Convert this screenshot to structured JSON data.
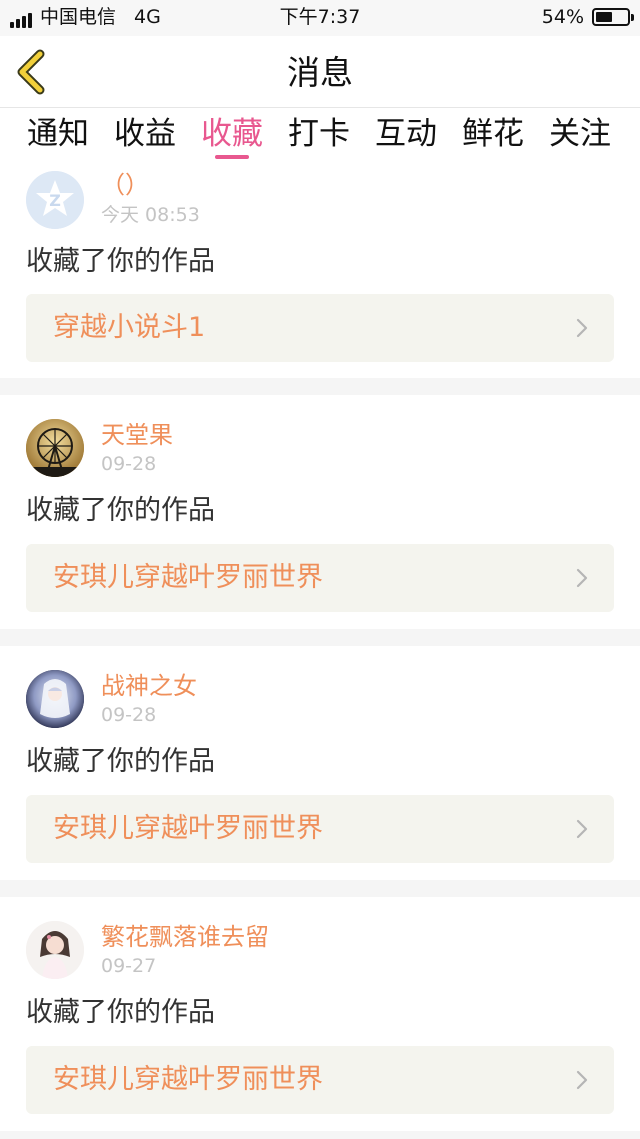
{
  "status_bar": {
    "carrier": "中国电信",
    "network": "4G",
    "time": "下午7:37",
    "battery_percent": "54%",
    "battery_level": 0.54
  },
  "header": {
    "title": "消息",
    "back_icon": "back-chevron-icon"
  },
  "tabs": [
    {
      "label": "通知",
      "active": false
    },
    {
      "label": "收益",
      "active": false
    },
    {
      "label": "收藏",
      "active": true
    },
    {
      "label": "打卡",
      "active": false
    },
    {
      "label": "互动",
      "active": false
    },
    {
      "label": "鲜花",
      "active": false
    },
    {
      "label": "关注",
      "active": false
    }
  ],
  "colors": {
    "accent": "#e8588f",
    "name_orange": "#ef8f5a",
    "box_bg": "#f4f4ee"
  },
  "feed": [
    {
      "user": "（）",
      "date": "今天 08:53",
      "action": "收藏了你的作品",
      "work": "穿越小说斗1",
      "avatar": "default-z-avatar"
    },
    {
      "user": "天堂果",
      "date": "09-28",
      "action": "收藏了你的作品",
      "work": "安琪儿穿越叶罗丽世界",
      "avatar": "ferris-wheel-avatar"
    },
    {
      "user": "战神之女",
      "date": "09-28",
      "action": "收藏了你的作品",
      "work": "安琪儿穿越叶罗丽世界",
      "avatar": "anime-girl-avatar"
    },
    {
      "user": "繁花飘落谁去留",
      "date": "09-27",
      "action": "收藏了你的作品",
      "work": "安琪儿穿越叶罗丽世界",
      "avatar": "girl-photo-avatar"
    }
  ]
}
